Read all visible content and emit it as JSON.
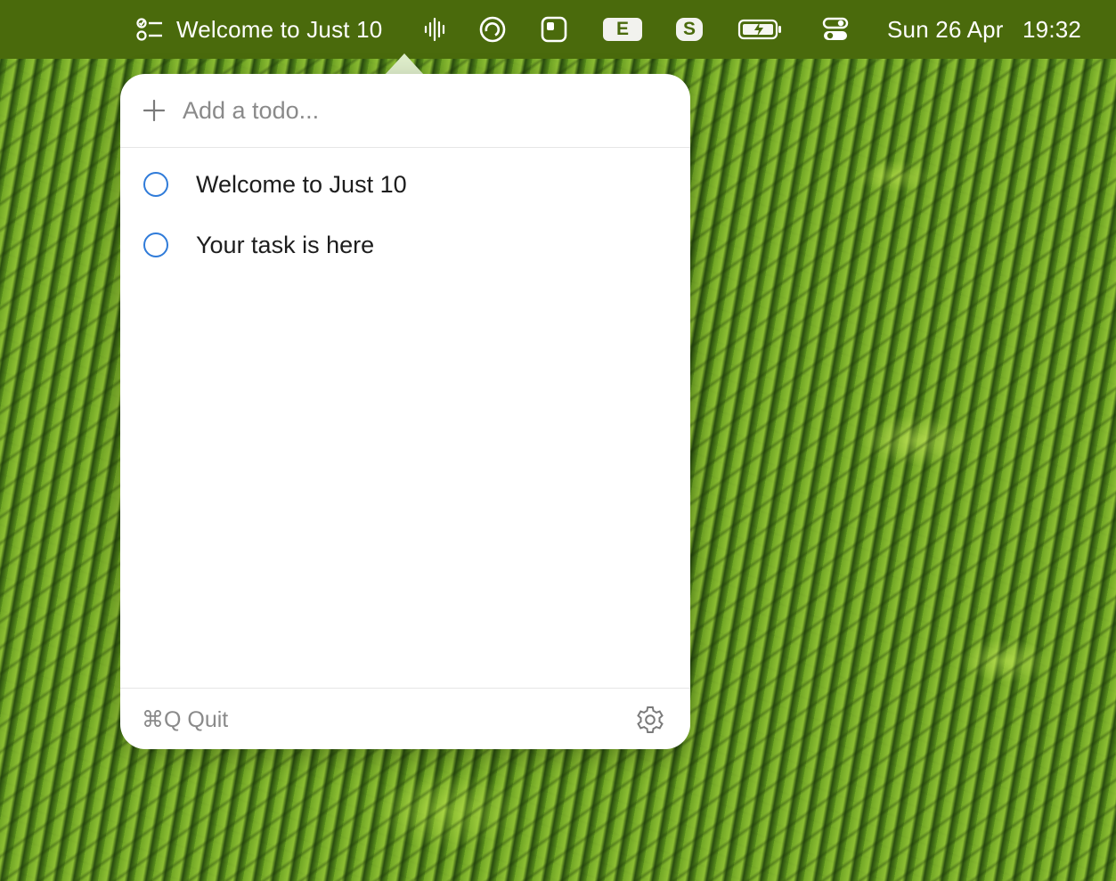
{
  "menubar": {
    "app_title": "Welcome to Just 10",
    "app_icon": "checklist-icon",
    "status_icons": [
      {
        "name": "waveform-icon"
      },
      {
        "name": "circle-sync-icon"
      },
      {
        "name": "window-icon"
      },
      {
        "name": "letter-e-icon",
        "label": "E"
      },
      {
        "name": "letter-s-icon",
        "label": "S"
      },
      {
        "name": "battery-icon"
      },
      {
        "name": "control-center-icon"
      }
    ],
    "date": "Sun 26 Apr",
    "time": "19:32"
  },
  "popover": {
    "add_placeholder": "Add a todo...",
    "todos": [
      {
        "label": "Welcome to Just 10",
        "done": false
      },
      {
        "label": "Your task is here",
        "done": false
      }
    ],
    "footer": {
      "quit_label": "⌘Q Quit",
      "settings_icon": "gear-icon"
    }
  },
  "colors": {
    "menubar": "#4a6a0c",
    "checkbox": "#2f7bd9",
    "popover_bg": "#ffffff",
    "muted_text": "#8a8a8a"
  }
}
